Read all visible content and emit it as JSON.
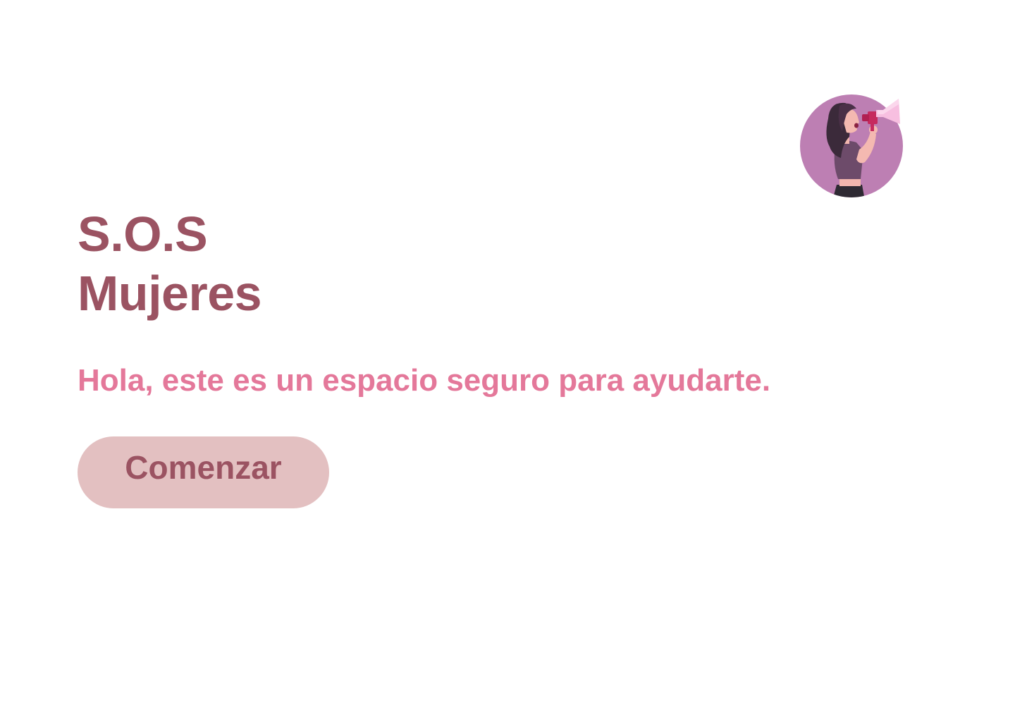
{
  "hero": {
    "title_line1": "S.O.S",
    "title_line2": "Mujeres",
    "subtitle": "Hola, este es un espacio seguro para ayudarte.",
    "cta_label": "Comenzar"
  },
  "illustration": {
    "name": "woman-megaphone-icon"
  },
  "colors": {
    "background": "#ffffff",
    "title": "#9b5362",
    "subtitle": "#e4789a",
    "button_bg": "#e3c0c1",
    "button_text": "#9b5362",
    "avatar_circle": "#bd7fb3"
  }
}
